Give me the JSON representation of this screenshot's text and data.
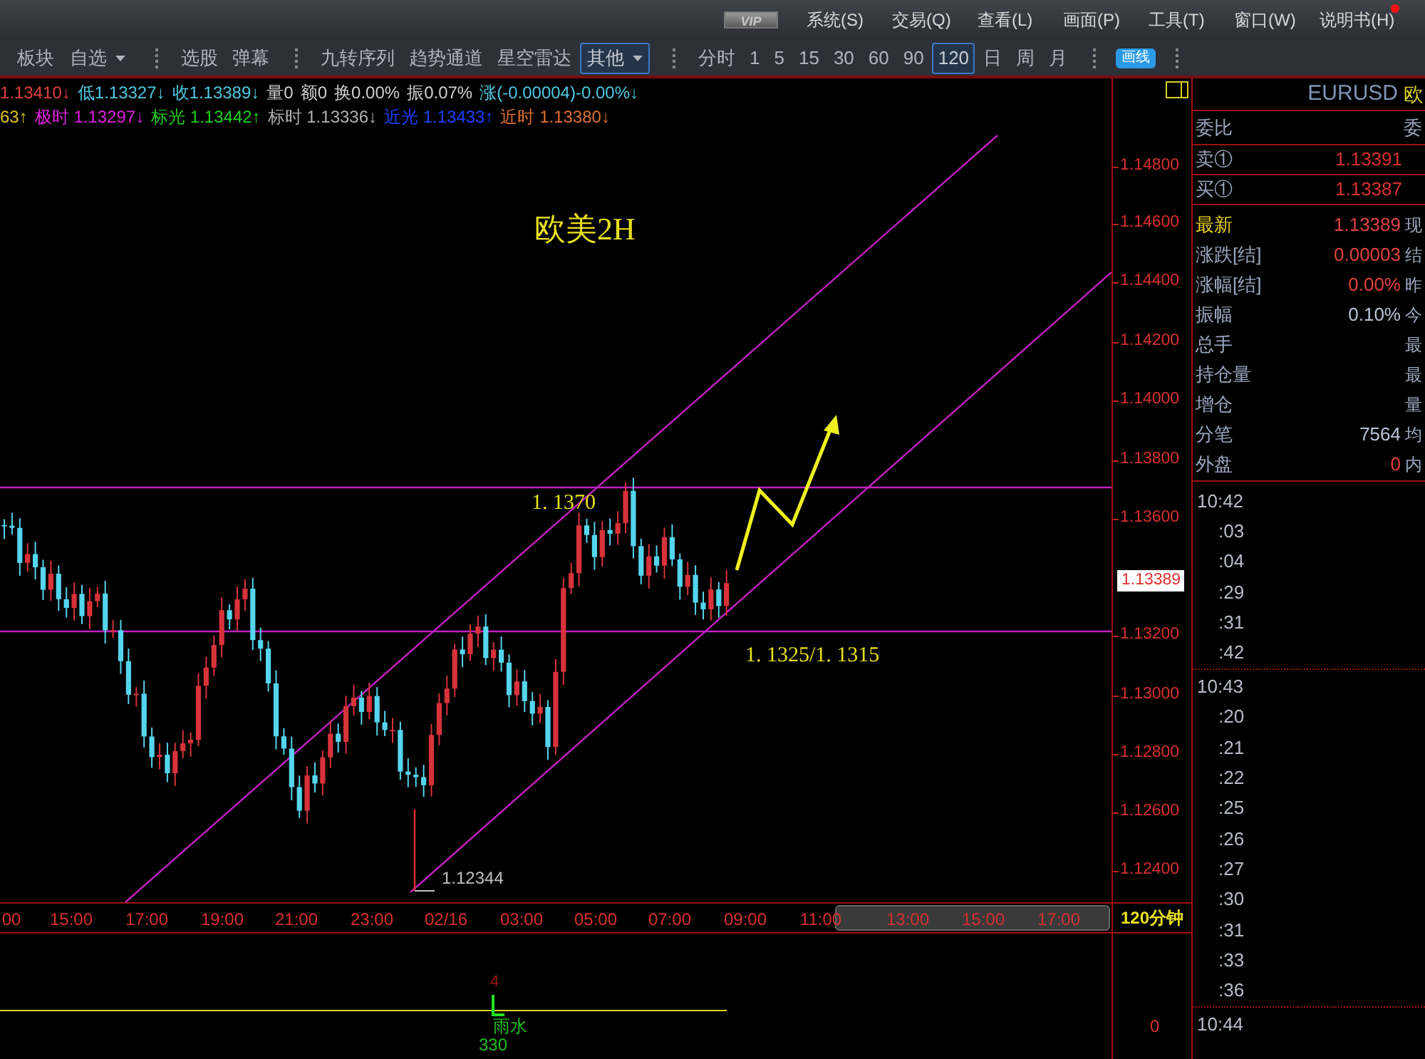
{
  "menu_bar": {
    "badge": "VIP",
    "items": [
      "系统(S)",
      "交易(Q)",
      "查看(L)",
      "画面(P)",
      "工具(T)",
      "窗口(W)",
      "说明书(H)"
    ],
    "notification": true
  },
  "toolbar": [
    {
      "kind": "text",
      "label": "板块",
      "selected": false
    },
    {
      "kind": "dropdown",
      "label": "自选",
      "selected": false
    },
    {
      "kind": "sep"
    },
    {
      "kind": "text",
      "label": "选股",
      "selected": false
    },
    {
      "kind": "text",
      "label": "弹幕",
      "selected": false
    },
    {
      "kind": "sep"
    },
    {
      "kind": "text",
      "label": "九转序列",
      "selected": false
    },
    {
      "kind": "text",
      "label": "趋势通道",
      "selected": false
    },
    {
      "kind": "text",
      "label": "星空雷达",
      "selected": false
    },
    {
      "kind": "dropdown",
      "label": "其他",
      "selected": true
    },
    {
      "kind": "sep"
    },
    {
      "kind": "text",
      "label": "分时",
      "selected": false
    },
    {
      "kind": "text",
      "label": "1",
      "selected": false
    },
    {
      "kind": "text",
      "label": "5",
      "selected": false
    },
    {
      "kind": "text",
      "label": "15",
      "selected": false
    },
    {
      "kind": "text",
      "label": "30",
      "selected": false
    },
    {
      "kind": "text",
      "label": "60",
      "selected": false
    },
    {
      "kind": "text",
      "label": "90",
      "selected": false
    },
    {
      "kind": "text",
      "label": "120",
      "selected": true
    },
    {
      "kind": "text",
      "label": "日",
      "selected": false
    },
    {
      "kind": "text",
      "label": "周",
      "selected": false
    },
    {
      "kind": "text",
      "label": "月",
      "selected": false
    },
    {
      "kind": "sep"
    },
    {
      "kind": "pill",
      "label": "画线",
      "selected": false
    },
    {
      "kind": "sep"
    }
  ],
  "info_rows": [
    [
      {
        "text": "1.13410↓",
        "color": "#e04040"
      },
      {
        "text": "低1.13327↓",
        "color": "#4fc8e0"
      },
      {
        "text": "收1.13389↓",
        "color": "#4fc8e0"
      },
      {
        "text": "量0",
        "color": "#d0d0d0"
      },
      {
        "text": "额0",
        "color": "#d0d0d0"
      },
      {
        "text": "换0.00%",
        "color": "#d0d0d0"
      },
      {
        "text": "振0.07%",
        "color": "#d0d0d0"
      },
      {
        "text": "涨(-0.00004)-0.00%↓",
        "color": "#4fc8e0"
      }
    ],
    [
      {
        "text": "63↑",
        "color": "#e0c020"
      },
      {
        "text": "极时 1.13297↓",
        "color": "#e020e0"
      },
      {
        "text": "标光 1.13442↑",
        "color": "#20d020"
      },
      {
        "text": "标时 1.13336↓",
        "color": "#b0b0b0"
      },
      {
        "text": "近光 1.13433↑",
        "color": "#2040ff"
      },
      {
        "text": "近时 1.13380↓",
        "color": "#e07030"
      }
    ]
  ],
  "chart": {
    "title": "欧美2H",
    "levels": [
      "1. 1370",
      "1. 1325/1. 1315"
    ],
    "low_label": "1.12344",
    "last_price": "1.13389"
  },
  "price_axis": [
    "1.14800",
    "1.14600",
    "1.14400",
    "1.14200",
    "1.14000",
    "1.13800",
    "1.13600",
    "1.13200",
    "1.13000",
    "1.12800",
    "1.12600",
    "1.12400"
  ],
  "time_axis": {
    "labels": [
      "00",
      "15:00",
      "17:00",
      "19:00",
      "21:00",
      "23:00",
      "02/16",
      "03:00",
      "05:00",
      "07:00",
      "09:00",
      "11:00",
      "13:00",
      "15:00",
      "17:00"
    ],
    "period": "120分钟"
  },
  "indicator": {
    "count": "4",
    "event": "雨水",
    "value": "330",
    "axis": "0"
  },
  "quote_panel": {
    "symbol": "EURUSD",
    "name": "欧",
    "ratio_label": "委比",
    "ratio_side": "委",
    "book": [
      {
        "label": "卖①",
        "value": "1.13391"
      },
      {
        "label": "买①",
        "value": "1.13387"
      }
    ],
    "rows": [
      {
        "kind": "latest",
        "label": "最新",
        "value": "1.13389",
        "color": "#e04040",
        "side": "现"
      },
      {
        "kind": "plain",
        "label": "涨跌[结]",
        "value": "0.00003",
        "color": "#e04040",
        "side": "结"
      },
      {
        "kind": "plain",
        "label": "涨幅[结]",
        "value": "0.00%",
        "color": "#e04040",
        "side": "昨"
      },
      {
        "kind": "plain",
        "label": "振幅",
        "value": "0.10%",
        "color": "#b8c4d8",
        "side": "今"
      },
      {
        "kind": "plain",
        "label": "总手",
        "side": "最"
      },
      {
        "kind": "plain",
        "label": "持仓量",
        "side": "最"
      },
      {
        "kind": "plain",
        "label": "增仓",
        "side": "量"
      },
      {
        "kind": "plain",
        "label": "分笔",
        "value": "7564",
        "color": "#b8c4d8",
        "side": "均"
      },
      {
        "kind": "plain",
        "label": "外盘",
        "value": "0",
        "color": "#e04040",
        "side": "内"
      }
    ]
  },
  "ticks": [
    {
      "minute": "10:42",
      "seconds": [
        ":03",
        ":04",
        ":29",
        ":31",
        ":42"
      ]
    },
    {
      "minute": "10:43",
      "seconds": [
        ":20",
        ":21",
        ":22",
        ":25",
        ":26",
        ":27",
        ":30",
        ":31",
        ":33",
        ":36"
      ]
    },
    {
      "minute": "10:44"
    }
  ]
}
